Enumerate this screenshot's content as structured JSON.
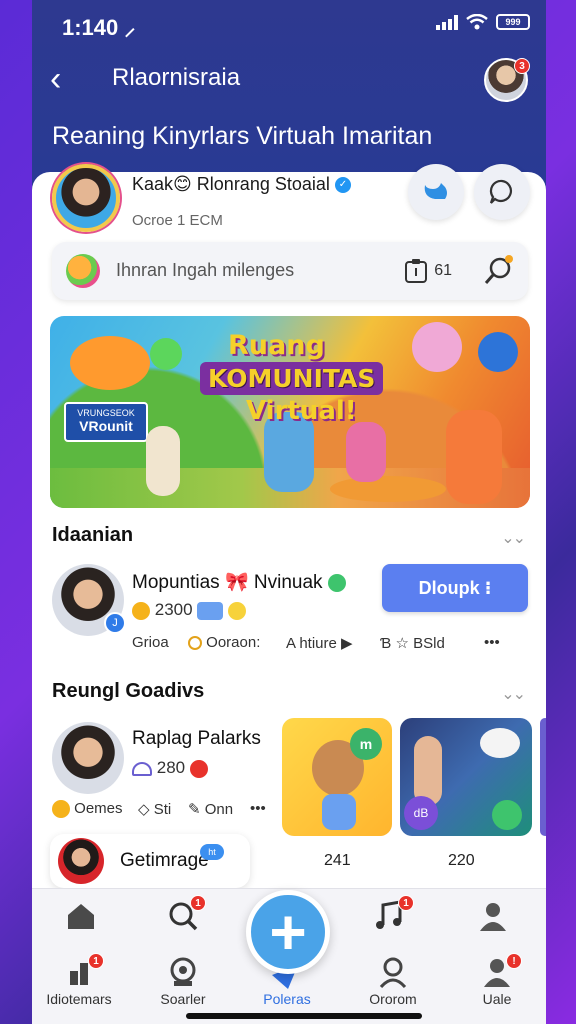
{
  "status_bar": {
    "time": "1:140 ⸝",
    "battery": "999"
  },
  "header": {
    "title": "Rlaornisraia",
    "subtitle": "Reaning Kinyrlars Virtuah Imaritan",
    "avatar_badge": "3"
  },
  "profile": {
    "name": "Kaak😊 Rlonrang Stoaial",
    "sub": "Ocroe 1 ECM"
  },
  "search": {
    "placeholder": "Ihnran Ingah milenges",
    "count": "61"
  },
  "banner": {
    "line1": "Ruang",
    "line2": "KOMUNITAS",
    "line3": "Virtual!",
    "sign_top": "VRUNGSEOK",
    "sign_main": "VRounit"
  },
  "section1": {
    "title": "Idaanian",
    "person_name": "Mopuntias 🎀 Nvinuak",
    "count": "2300",
    "button_label": "Dloupk ⁝",
    "meta": [
      "Grioa",
      "Ooraon:",
      "A htiure ▶",
      "Ɓ ☆ BSld",
      "•••"
    ]
  },
  "section2": {
    "title": "Reungl Goadivs",
    "person_name": "Raplag Palarks",
    "count": "280",
    "meta": [
      "Oemes",
      "Sti",
      "Onn",
      "•••"
    ],
    "chip_label": "Getimrage",
    "chip_badge": "ht",
    "num1": "241",
    "num2": "220"
  },
  "bottom_nav": {
    "labels": [
      "Idiotemars",
      "Soarler",
      "Poleras",
      "Ororom",
      "Uale"
    ],
    "badges": [
      "1",
      "1",
      "1"
    ]
  },
  "colors": {
    "accent": "#2e3990",
    "button": "#5b7ff0",
    "fab": "#4aa3e8",
    "badge": "#e8322b"
  }
}
